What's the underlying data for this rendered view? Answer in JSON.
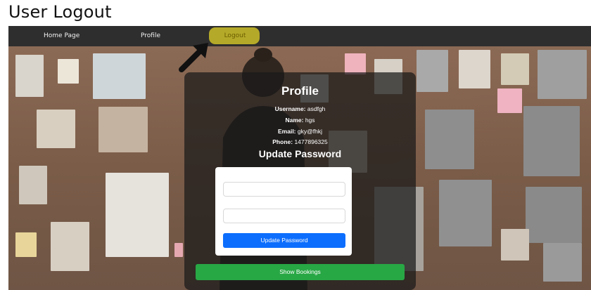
{
  "doc_title": "User Logout",
  "nav": {
    "home": "Home Page",
    "profile": "Profile",
    "logout": "Logout"
  },
  "profile": {
    "title": "Profile",
    "username_label": "Username:",
    "username": "asdfgh",
    "name_label": "Name:",
    "name": "hgs",
    "email_label": "Email:",
    "email": "gky@fhkj",
    "phone_label": "Phone:",
    "phone": "1477896325"
  },
  "update": {
    "title": "Update Password",
    "button": "Update Password"
  },
  "bookings_button": "Show Bookings",
  "colors": {
    "navbar": "#2e2e2e",
    "highlight": "#cdbe28",
    "primary": "#0d6efd",
    "success": "#28a745"
  }
}
